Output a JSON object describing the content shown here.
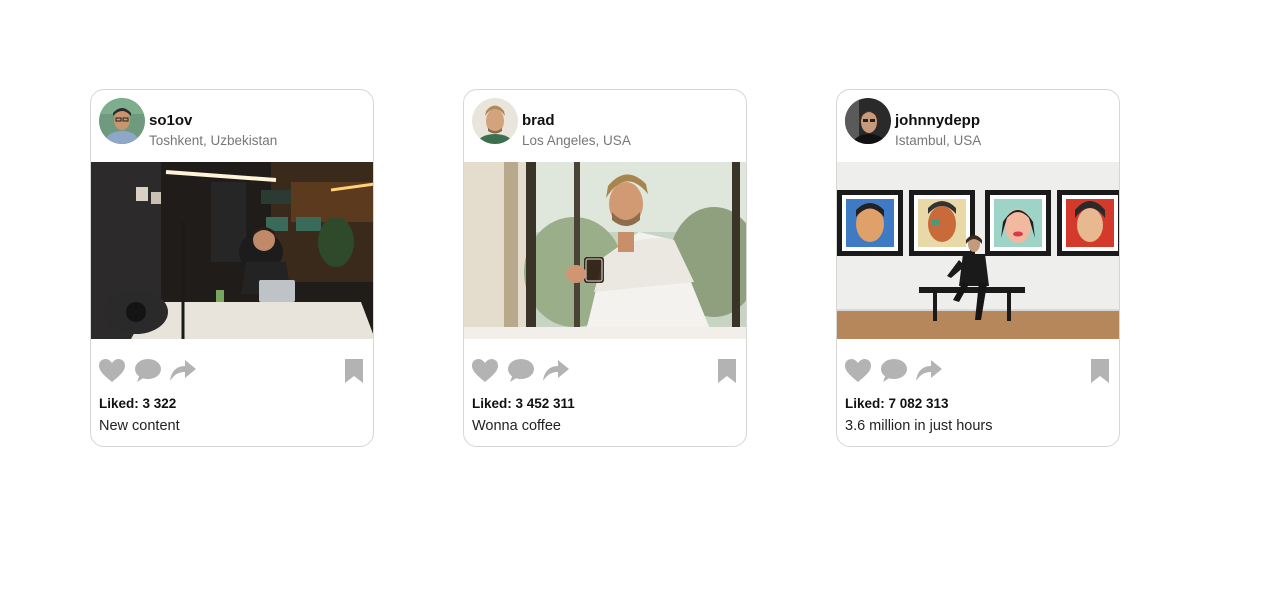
{
  "posts": [
    {
      "username": "so1ov",
      "location": "Toshkent, Uzbekistan",
      "likes": "Liked: 3 322",
      "caption": "New content"
    },
    {
      "username": "brad",
      "location": "Los Angeles, USA",
      "likes": "Liked: 3 452 311",
      "caption": "Wonna coffee"
    },
    {
      "username": "johnnydepp",
      "location": "Istambul, USA",
      "likes": "Liked: 7 082 313",
      "caption": "3.6 million in just hours"
    }
  ],
  "icons": {
    "like": "heart-icon",
    "comment": "comment-icon",
    "share": "share-icon",
    "save": "bookmark-icon"
  },
  "colors": {
    "icon": "#b3b3b3",
    "card_border": "#d6d6d6"
  }
}
